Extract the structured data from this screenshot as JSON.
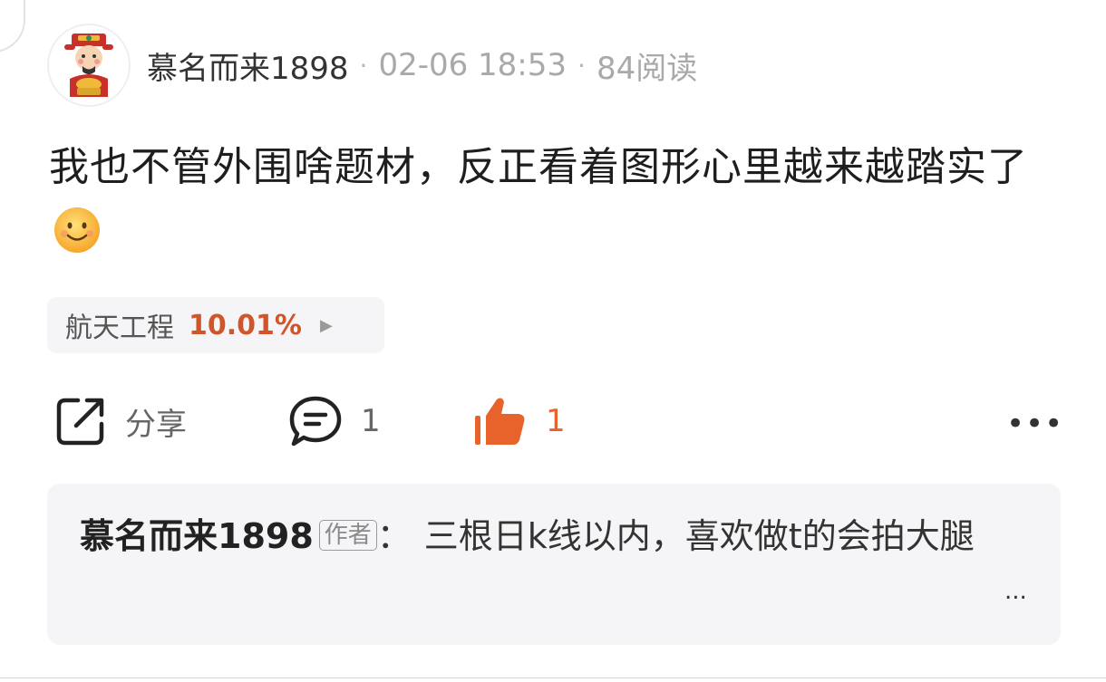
{
  "post": {
    "author": "慕名而来1898",
    "separator": "·",
    "time": "02-06 18:53",
    "reads": "84阅读",
    "text": "我也不管外围啥题材，反正看着图形心里越来越踏实了",
    "emoji_icon": "smiley-face-emoji"
  },
  "stock_tag": {
    "name": "航天工程",
    "change": "10.01%",
    "change_color": "#d2552a"
  },
  "actions": {
    "share_label": "分享",
    "comment_count": "1",
    "like_count": "1",
    "like_color": "#e8622c",
    "more_label": "•••"
  },
  "comment": {
    "user": "慕名而来1898",
    "badge": "作者",
    "colon": "：",
    "text": "三根日k线以内，喜欢做t的会拍大腿",
    "more_label": "..."
  }
}
